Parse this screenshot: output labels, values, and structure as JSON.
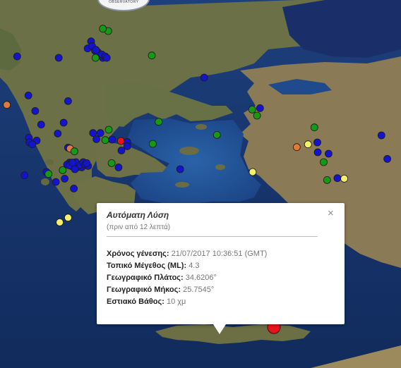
{
  "map": {
    "type": "satellite",
    "epicenter_color": "#e8141b",
    "marker_colors": {
      "blue": "#1414cc",
      "green": "#169a16",
      "yellow": "#f5f06a",
      "orange": "#e07a3a",
      "red": "#e8141b"
    },
    "markers": [
      {
        "lat": 40.92,
        "lon": 22.37,
        "color": "green"
      },
      {
        "lat": 40.97,
        "lon": 22.26,
        "color": "green"
      },
      {
        "lat": 40.7,
        "lon": 22.02,
        "color": "blue"
      },
      {
        "lat": 40.55,
        "lon": 21.95,
        "color": "blue"
      },
      {
        "lat": 40.6,
        "lon": 22.04,
        "color": "blue"
      },
      {
        "lat": 40.5,
        "lon": 22.1,
        "color": "blue"
      },
      {
        "lat": 40.47,
        "lon": 22.16,
        "color": "blue"
      },
      {
        "lat": 40.52,
        "lon": 22.12,
        "color": "blue"
      },
      {
        "lat": 40.35,
        "lon": 22.26,
        "color": "blue"
      },
      {
        "lat": 40.42,
        "lon": 22.24,
        "color": "blue"
      },
      {
        "lat": 40.38,
        "lon": 22.31,
        "color": "blue"
      },
      {
        "lat": 40.35,
        "lon": 22.34,
        "color": "blue"
      },
      {
        "lat": 40.35,
        "lon": 22.11,
        "color": "green"
      },
      {
        "lat": 40.4,
        "lon": 23.26,
        "color": "green"
      },
      {
        "lat": 40.38,
        "lon": 20.51,
        "color": "blue"
      },
      {
        "lat": 40.35,
        "lon": 21.36,
        "color": "blue"
      },
      {
        "lat": 39.93,
        "lon": 24.33,
        "color": "blue"
      },
      {
        "lat": 39.25,
        "lon": 25.31,
        "color": "green"
      },
      {
        "lat": 39.12,
        "lon": 25.41,
        "color": "green"
      },
      {
        "lat": 39.28,
        "lon": 25.47,
        "color": "blue"
      },
      {
        "lat": 39.55,
        "lon": 20.74,
        "color": "blue"
      },
      {
        "lat": 39.35,
        "lon": 20.3,
        "color": "orange"
      },
      {
        "lat": 39.22,
        "lon": 20.88,
        "color": "blue"
      },
      {
        "lat": 39.43,
        "lon": 21.55,
        "color": "blue"
      },
      {
        "lat": 38.97,
        "lon": 21.46,
        "color": "blue"
      },
      {
        "lat": 38.93,
        "lon": 21.0,
        "color": "blue"
      },
      {
        "lat": 38.65,
        "lon": 20.75,
        "color": "blue"
      },
      {
        "lat": 38.59,
        "lon": 20.91,
        "color": "blue"
      },
      {
        "lat": 38.55,
        "lon": 20.76,
        "color": "blue"
      },
      {
        "lat": 38.51,
        "lon": 20.82,
        "color": "blue"
      },
      {
        "lat": 38.74,
        "lon": 21.34,
        "color": "blue"
      },
      {
        "lat": 38.44,
        "lon": 21.55,
        "color": "blue"
      },
      {
        "lat": 38.42,
        "lon": 21.59,
        "color": "orange"
      },
      {
        "lat": 38.36,
        "lon": 21.68,
        "color": "green"
      },
      {
        "lat": 38.12,
        "lon": 21.58,
        "color": "blue"
      },
      {
        "lat": 38.04,
        "lon": 21.63,
        "color": "blue"
      },
      {
        "lat": 38.02,
        "lon": 21.74,
        "color": "blue"
      },
      {
        "lat": 38.02,
        "lon": 21.83,
        "color": "blue"
      },
      {
        "lat": 38.08,
        "lon": 21.72,
        "color": "blue"
      },
      {
        "lat": 38.13,
        "lon": 21.71,
        "color": "blue"
      },
      {
        "lat": 38.08,
        "lon": 21.53,
        "color": "blue"
      },
      {
        "lat": 38.06,
        "lon": 21.58,
        "color": "blue"
      },
      {
        "lat": 38.12,
        "lon": 21.64,
        "color": "blue"
      },
      {
        "lat": 38.07,
        "lon": 21.8,
        "color": "blue"
      },
      {
        "lat": 38.13,
        "lon": 21.86,
        "color": "blue"
      },
      {
        "lat": 38.08,
        "lon": 21.9,
        "color": "blue"
      },
      {
        "lat": 38.05,
        "lon": 21.96,
        "color": "blue"
      },
      {
        "lat": 38.11,
        "lon": 21.93,
        "color": "blue"
      },
      {
        "lat": 37.98,
        "lon": 21.69,
        "color": "blue"
      },
      {
        "lat": 37.96,
        "lon": 21.44,
        "color": "green"
      },
      {
        "lat": 37.92,
        "lon": 21.11,
        "color": "blue"
      },
      {
        "lat": 37.88,
        "lon": 21.15,
        "color": "green"
      },
      {
        "lat": 37.85,
        "lon": 20.66,
        "color": "blue"
      },
      {
        "lat": 37.78,
        "lon": 21.48,
        "color": "blue"
      },
      {
        "lat": 37.71,
        "lon": 21.3,
        "color": "blue"
      },
      {
        "lat": 37.57,
        "lon": 21.67,
        "color": "blue"
      },
      {
        "lat": 36.95,
        "lon": 21.55,
        "color": "yellow"
      },
      {
        "lat": 36.85,
        "lon": 21.38,
        "color": "yellow"
      },
      {
        "lat": 38.75,
        "lon": 22.21,
        "color": "blue"
      },
      {
        "lat": 38.75,
        "lon": 22.06,
        "color": "blue"
      },
      {
        "lat": 38.82,
        "lon": 22.38,
        "color": "green"
      },
      {
        "lat": 38.62,
        "lon": 22.13,
        "color": "blue"
      },
      {
        "lat": 38.6,
        "lon": 22.31,
        "color": "green"
      },
      {
        "lat": 38.61,
        "lon": 22.45,
        "color": "blue"
      },
      {
        "lat": 38.58,
        "lon": 22.63,
        "color": "red"
      },
      {
        "lat": 38.56,
        "lon": 22.76,
        "color": "blue"
      },
      {
        "lat": 38.47,
        "lon": 22.76,
        "color": "blue"
      },
      {
        "lat": 38.52,
        "lon": 23.28,
        "color": "green"
      },
      {
        "lat": 38.38,
        "lon": 22.64,
        "color": "blue"
      },
      {
        "lat": 38.02,
        "lon": 22.58,
        "color": "blue"
      },
      {
        "lat": 38.11,
        "lon": 22.44,
        "color": "green"
      },
      {
        "lat": 37.98,
        "lon": 23.84,
        "color": "blue"
      },
      {
        "lat": 38.99,
        "lon": 23.4,
        "color": "green"
      },
      {
        "lat": 38.71,
        "lon": 24.59,
        "color": "green"
      },
      {
        "lat": 38.51,
        "lon": 26.45,
        "color": "yellow"
      },
      {
        "lat": 38.87,
        "lon": 26.58,
        "color": "green"
      },
      {
        "lat": 38.45,
        "lon": 26.22,
        "color": "orange"
      },
      {
        "lat": 38.55,
        "lon": 26.64,
        "color": "blue"
      },
      {
        "lat": 38.34,
        "lon": 26.65,
        "color": "blue"
      },
      {
        "lat": 38.31,
        "lon": 26.87,
        "color": "blue"
      },
      {
        "lat": 38.13,
        "lon": 26.77,
        "color": "green"
      },
      {
        "lat": 38.7,
        "lon": 27.95,
        "color": "blue"
      },
      {
        "lat": 38.2,
        "lon": 28.07,
        "color": "blue"
      },
      {
        "lat": 38.41,
        "lon": 28.47,
        "color": "blue"
      },
      {
        "lat": 37.92,
        "lon": 25.32,
        "color": "yellow"
      },
      {
        "lat": 37.75,
        "lon": 26.84,
        "color": "green"
      },
      {
        "lat": 37.79,
        "lon": 27.05,
        "color": "blue"
      },
      {
        "lat": 37.78,
        "lon": 27.19,
        "color": "yellow"
      },
      {
        "lat": 34.83,
        "lon": 25.4,
        "color": "blue"
      },
      {
        "lat": 34.89,
        "lon": 25.3,
        "color": "yellow"
      }
    ],
    "epicenter": {
      "lat": 34.6206,
      "lon": 25.7545
    }
  },
  "logo": {
    "text": "OBSERVATORY"
  },
  "popup": {
    "title": "Αυτόματη Λύση",
    "subtitle": "(πριν από 12 λεπτά)",
    "close": "×",
    "rows": [
      {
        "label": "Χρόνος γένεσης:",
        "value": "21/07/2017  10:36:51 (GMT)"
      },
      {
        "label": "Τοπικό Μέγεθος (ML):",
        "value": "4.3"
      },
      {
        "label": "Γεωγραφικό Πλάτος:",
        "value": "34.6206°"
      },
      {
        "label": "Γεωγραφικό Μήκος:",
        "value": "25.7545°"
      },
      {
        "label": "Εστιακό Βάθος:",
        "value": "10 χμ"
      }
    ]
  }
}
